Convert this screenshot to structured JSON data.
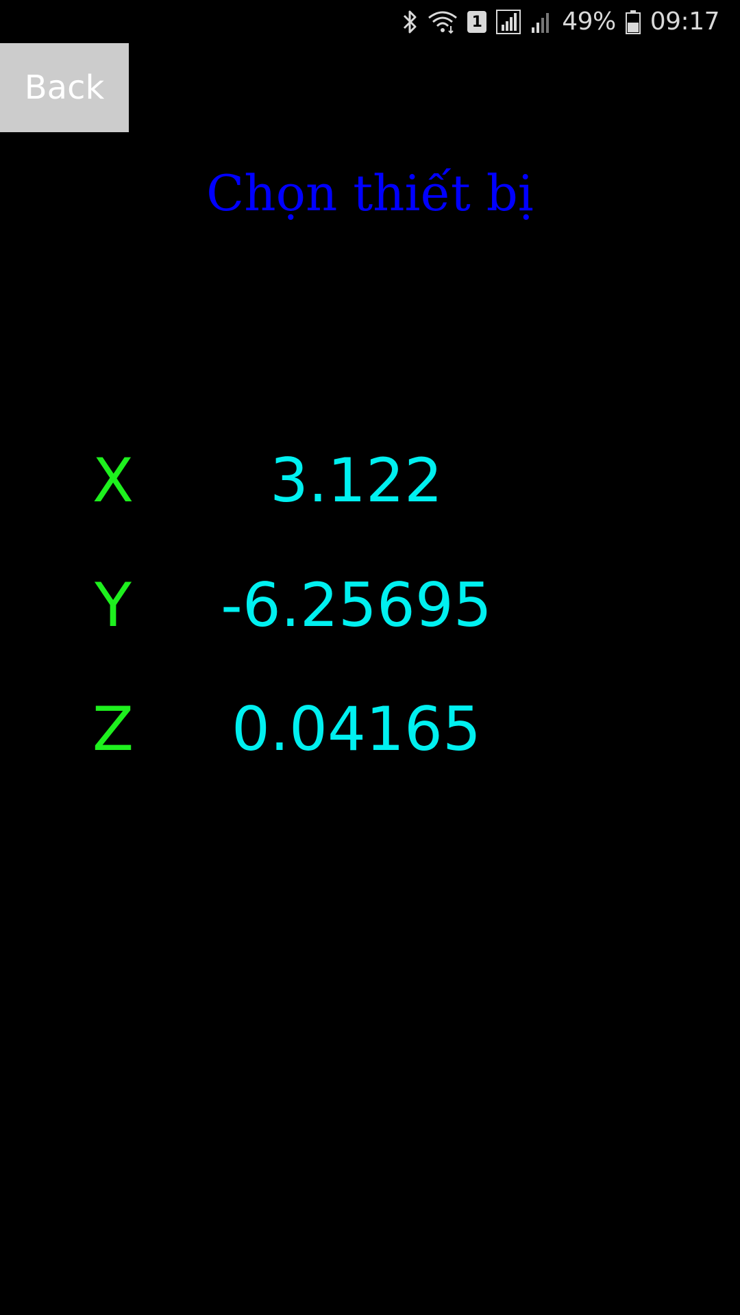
{
  "status_bar": {
    "battery_percent": "49%",
    "time": "09:17",
    "sim_slot": "1",
    "icons": [
      "bluetooth-icon",
      "wifi-icon",
      "sim-icon",
      "signal-icon",
      "signal-weak-icon",
      "battery-icon"
    ]
  },
  "header": {
    "back_label": "Back",
    "title": "Chọn thiết bị"
  },
  "axes": {
    "x": {
      "label": "X",
      "value": "3.122"
    },
    "y": {
      "label": "Y",
      "value": "-6.25695"
    },
    "z": {
      "label": "Z",
      "value": "0.04165"
    }
  },
  "colors": {
    "background": "#000000",
    "title": "#0000ff",
    "axis_label": "#1ef01e",
    "axis_value": "#00f0f0",
    "back_button_bg": "#cccccc"
  }
}
